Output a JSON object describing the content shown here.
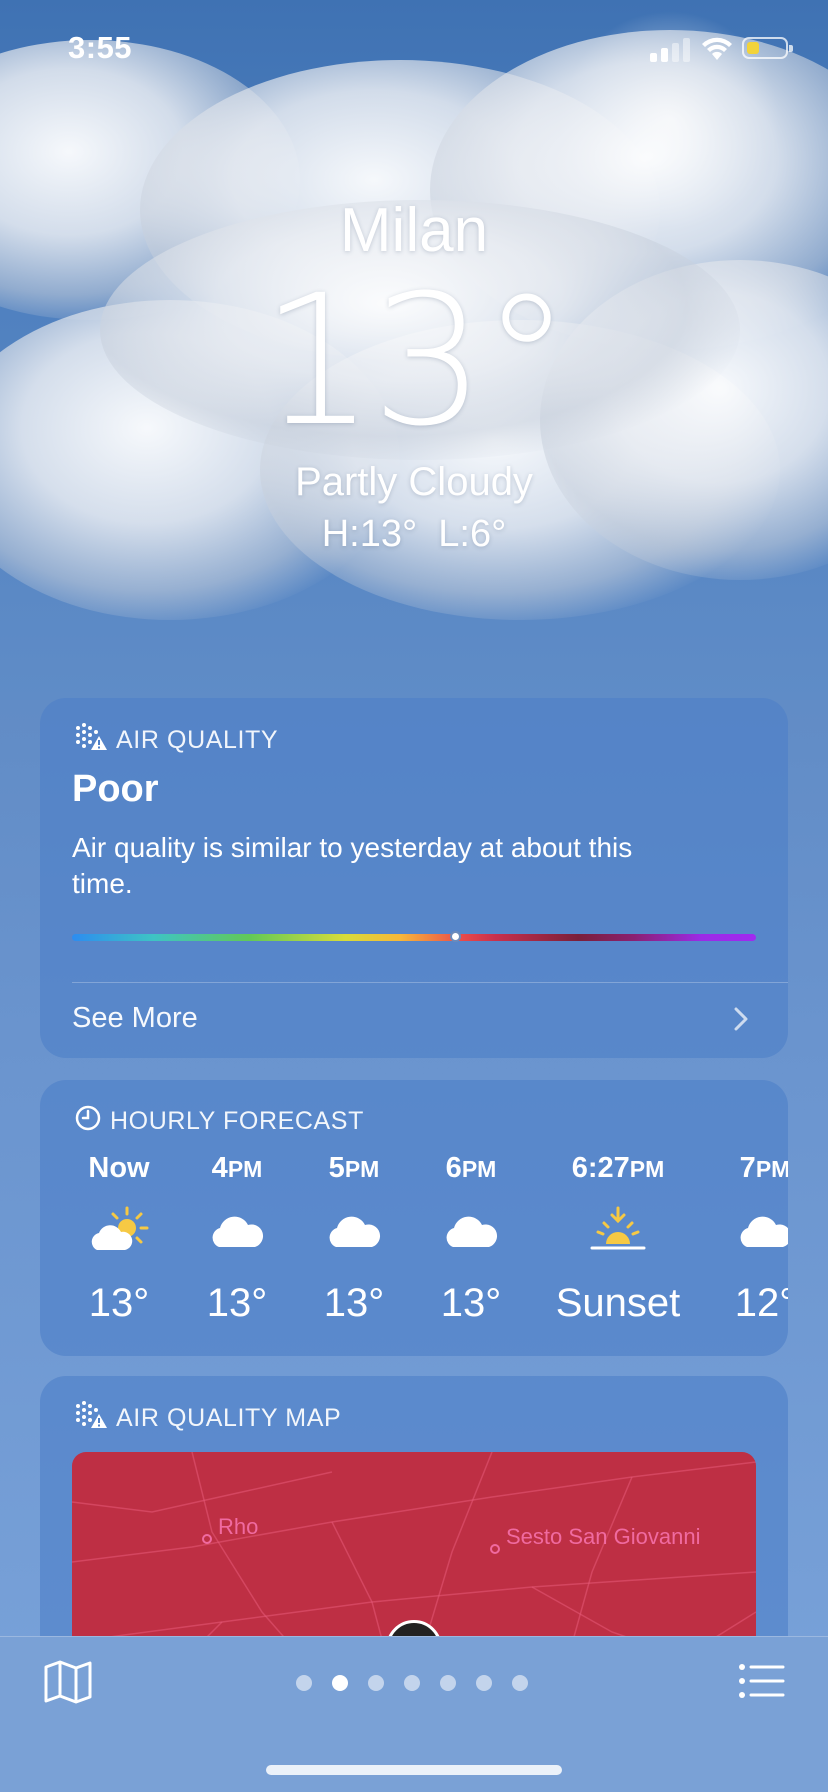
{
  "status_bar": {
    "time": "3:55"
  },
  "location": {
    "city": "Milan",
    "temperature": "13°",
    "condition": "Partly Cloudy",
    "high_low": "H:13°  L:6°"
  },
  "air_quality": {
    "title": "AIR QUALITY",
    "level": "Poor",
    "description": "Air quality is similar to yesterday at about this time.",
    "index_position_fraction": 0.56,
    "see_more": "See More"
  },
  "hourly_forecast": {
    "title": "HOURLY FORECAST",
    "hours": [
      {
        "time": "Now",
        "suffix": "",
        "icon": "partly-sunny-icon",
        "temp": "13°"
      },
      {
        "time": "4",
        "suffix": "PM",
        "icon": "cloud-icon",
        "temp": "13°"
      },
      {
        "time": "5",
        "suffix": "PM",
        "icon": "cloud-icon",
        "temp": "13°"
      },
      {
        "time": "6",
        "suffix": "PM",
        "icon": "cloud-icon",
        "temp": "13°"
      },
      {
        "time": "6:27",
        "suffix": "PM",
        "icon": "sunset-icon",
        "temp": "Sunset"
      },
      {
        "time": "7",
        "suffix": "PM",
        "icon": "cloud-icon",
        "temp": "12°"
      }
    ]
  },
  "air_quality_map": {
    "title": "AIR QUALITY MAP",
    "places": [
      "Rho",
      "Sesto San Giovanni"
    ]
  },
  "toolbar": {
    "page_count": 7,
    "active_page": 1
  },
  "colors": {
    "card_background": "#4e80c8",
    "map_fill": "#be2f44",
    "map_label": "#f06aa0",
    "battery": "#f2d33a"
  }
}
